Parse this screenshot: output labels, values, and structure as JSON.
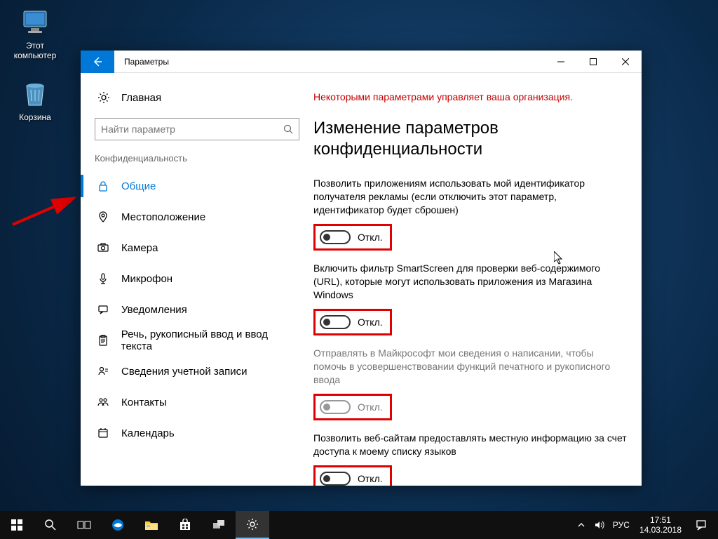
{
  "desktop_icons": {
    "computer": "Этот компьютер",
    "recycle": "Корзина"
  },
  "window": {
    "title": "Параметры"
  },
  "nav": {
    "home": "Главная",
    "search_placeholder": "Найти параметр",
    "section": "Конфиденциальность",
    "items": [
      "Общие",
      "Местоположение",
      "Камера",
      "Микрофон",
      "Уведомления",
      "Речь, рукописный ввод и ввод текста",
      "Сведения учетной записи",
      "Контакты",
      "Календарь"
    ]
  },
  "content": {
    "org_banner": "Некоторыми параметрами управляет ваша организация.",
    "heading": "Изменение параметров конфиденциальности",
    "toggles": [
      {
        "desc": "Позволить приложениям использовать мой идентификатор получателя рекламы (если отключить этот параметр, идентификатор будет сброшен)",
        "label": "Откл.",
        "state": "off",
        "disabled": false,
        "highlighted": true
      },
      {
        "desc": "Включить фильтр SmartScreen для проверки веб-содержимого (URL), которые могут использовать приложения из Магазина Windows",
        "label": "Откл.",
        "state": "off",
        "disabled": false,
        "highlighted": true
      },
      {
        "desc": "Отправлять в Майкрософт мои сведения о написании, чтобы помочь в усовершенствовании функций печатного и рукописного ввода",
        "label": "Откл.",
        "state": "off",
        "disabled": true,
        "highlighted": true
      },
      {
        "desc": "Позволить веб-сайтам предоставлять местную информацию за счет доступа к моему списку языков",
        "label": "Откл.",
        "state": "off",
        "disabled": false,
        "highlighted": true
      }
    ]
  },
  "taskbar": {
    "lang": "РУС",
    "time": "17:51",
    "date": "14.03.2018"
  }
}
